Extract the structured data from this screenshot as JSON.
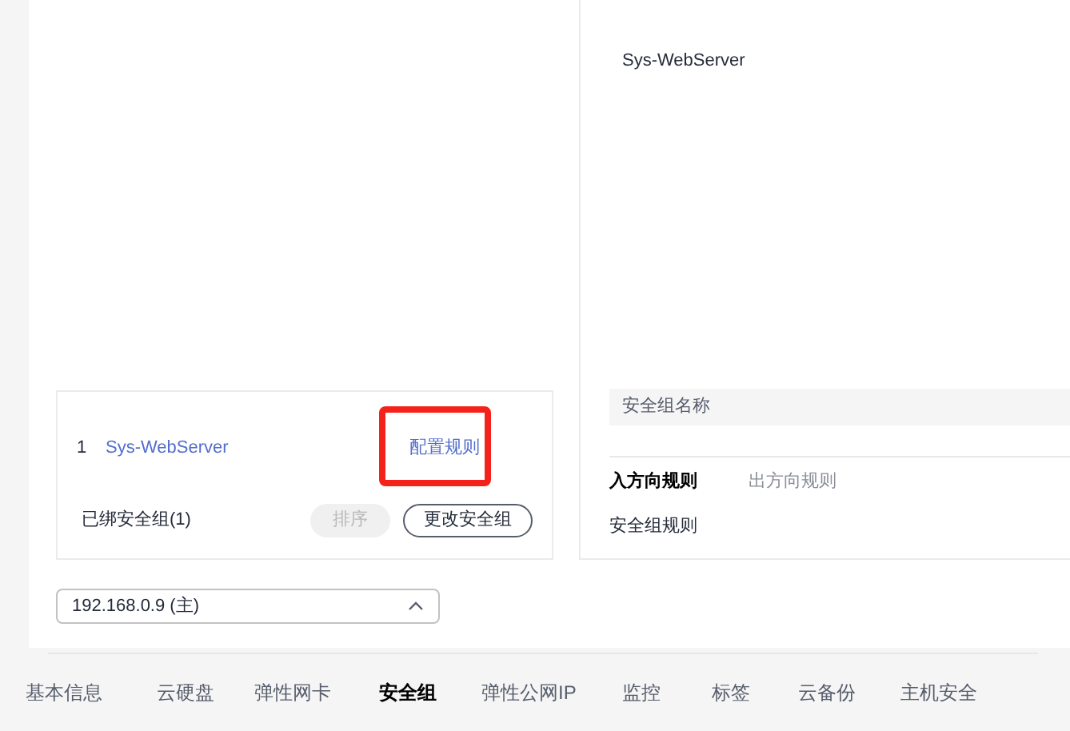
{
  "rules_panel": {
    "group_name": "Sys-WebServer",
    "header_label": "安全组名称",
    "directions": [
      {
        "label": "入方向规则",
        "selected": true
      },
      {
        "label": "出方向规则",
        "selected": false
      }
    ],
    "title": "安全组规则"
  },
  "bound_groups": {
    "rows": [
      {
        "index": "1",
        "name": "Sys-WebServer",
        "action": "配置规则"
      }
    ],
    "title": "已绑安全组(1)",
    "buttons": [
      {
        "label": "排序",
        "disabled": true
      },
      {
        "label": "更改安全组",
        "disabled": false
      }
    ]
  },
  "nic_select": {
    "value": "192.168.0.9 (主)"
  },
  "tabs": [
    {
      "label": "基本信息",
      "selected": false
    },
    {
      "label": "云硬盘",
      "selected": false
    },
    {
      "label": "弹性网卡",
      "selected": false
    },
    {
      "label": "安全组",
      "selected": true
    },
    {
      "label": "弹性公网IP",
      "selected": false
    },
    {
      "label": "监控",
      "selected": false
    },
    {
      "label": "标签",
      "selected": false
    },
    {
      "label": "云备份",
      "selected": false
    },
    {
      "label": "主机安全",
      "selected": false
    }
  ]
}
